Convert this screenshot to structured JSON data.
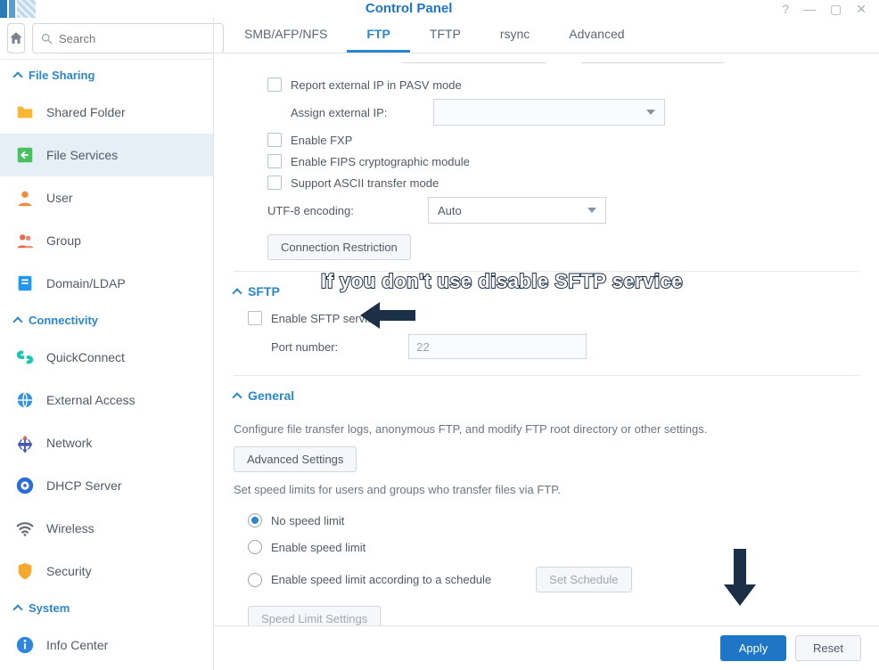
{
  "window": {
    "title": "Control Panel"
  },
  "search": {
    "placeholder": "Search"
  },
  "sidebar": {
    "sections": {
      "file_sharing": {
        "label": "File Sharing",
        "items": [
          {
            "label": "Shared Folder",
            "icon": "folder-icon",
            "color": "#f7b733"
          },
          {
            "label": "File Services",
            "icon": "file-services-icon",
            "color": "#49c05f"
          },
          {
            "label": "User",
            "icon": "user-icon",
            "color": "#f08b3c"
          },
          {
            "label": "Group",
            "icon": "group-icon",
            "color": "#e46a4a"
          },
          {
            "label": "Domain/LDAP",
            "icon": "domain-icon",
            "color": "#2196f3"
          }
        ]
      },
      "connectivity": {
        "label": "Connectivity",
        "items": [
          {
            "label": "QuickConnect",
            "icon": "quickconnect-icon",
            "color": "#1cc6b0"
          },
          {
            "label": "External Access",
            "icon": "external-access-icon",
            "color": "#3590e8"
          },
          {
            "label": "Network",
            "icon": "network-icon",
            "color": "#4456b6"
          },
          {
            "label": "DHCP Server",
            "icon": "dhcp-icon",
            "color": "#2b6dd8"
          },
          {
            "label": "Wireless",
            "icon": "wireless-icon",
            "color": "#6b6f78"
          },
          {
            "label": "Security",
            "icon": "security-icon",
            "color": "#f7a92e"
          }
        ]
      },
      "system": {
        "label": "System",
        "items": [
          {
            "label": "Info Center",
            "icon": "info-icon",
            "color": "#2e86e0"
          }
        ]
      }
    }
  },
  "tabs": [
    {
      "label": "SMB/AFP/NFS"
    },
    {
      "label": "FTP"
    },
    {
      "label": "TFTP"
    },
    {
      "label": "rsync"
    },
    {
      "label": "Advanced"
    }
  ],
  "active_tab": 1,
  "ftp": {
    "report_ext_ip": "Report external IP in PASV mode",
    "assign_ext_ip": "Assign external IP:",
    "enable_fxp": "Enable FXP",
    "enable_fips": "Enable FIPS cryptographic module",
    "support_ascii": "Support ASCII transfer mode",
    "utf8_label": "UTF-8 encoding:",
    "utf8_value": "Auto",
    "conn_restriction": "Connection Restriction"
  },
  "sftp": {
    "heading": "SFTP",
    "enable": "Enable SFTP service",
    "port_label": "Port number:",
    "port_value": "22"
  },
  "general": {
    "heading": "General",
    "desc": "Configure file transfer logs, anonymous FTP, and modify FTP root directory or other settings.",
    "adv_settings": "Advanced Settings",
    "speed_desc": "Set speed limits for users and groups who transfer files via FTP.",
    "radios": {
      "none": "No speed limit",
      "enable": "Enable speed limit",
      "schedule": "Enable speed limit according to a schedule"
    },
    "set_schedule": "Set Schedule",
    "speed_settings": "Speed Limit Settings"
  },
  "footer": {
    "apply": "Apply",
    "reset": "Reset"
  },
  "annotation": {
    "text": "If you don't use disable SFTP service"
  }
}
